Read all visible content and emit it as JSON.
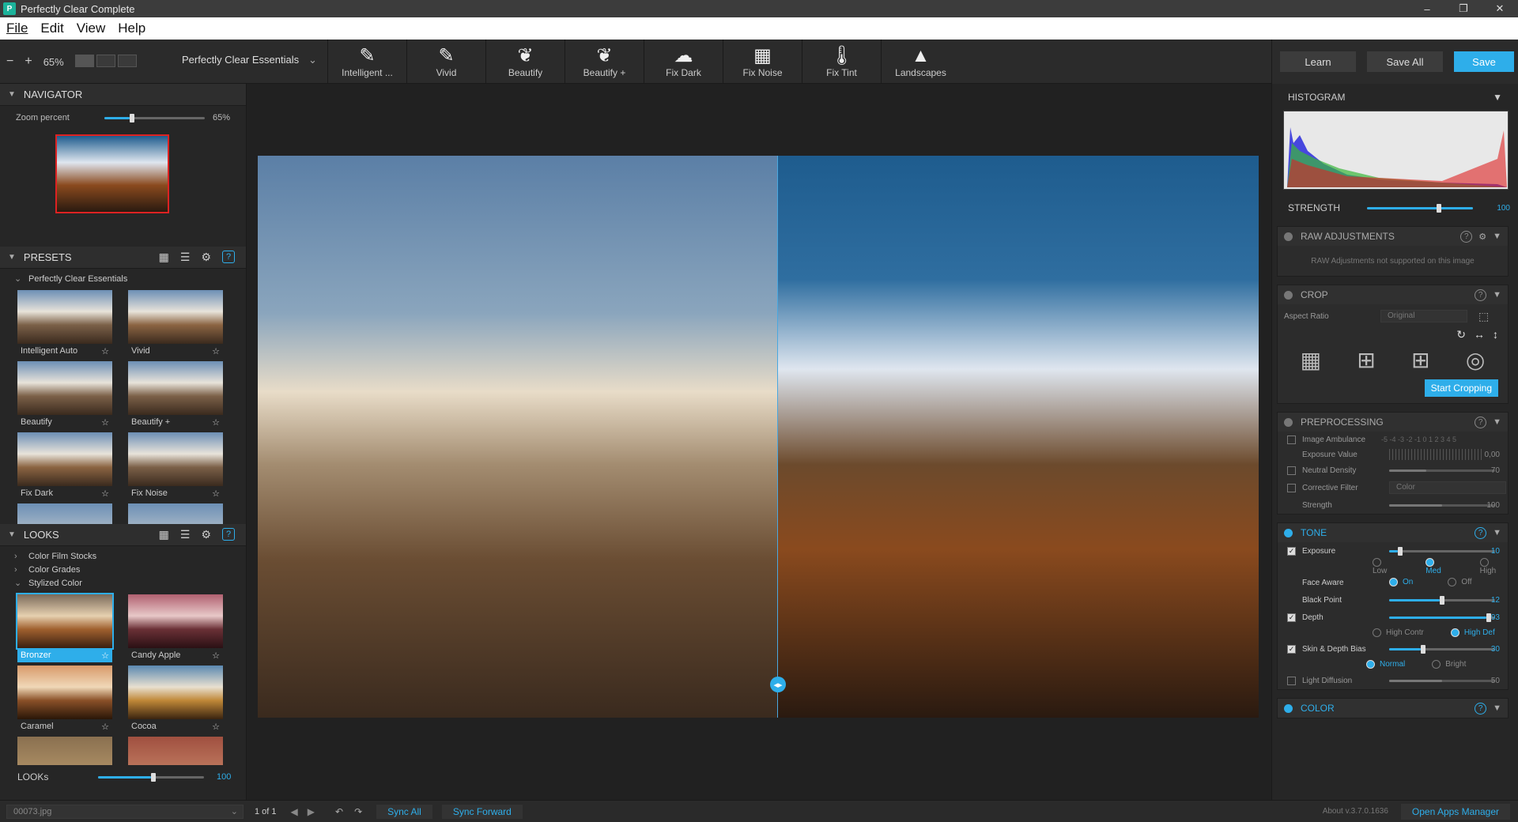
{
  "window": {
    "title": "Perfectly Clear Complete",
    "minimize": "–",
    "maximize": "❐",
    "close": "✕"
  },
  "menu": [
    "File",
    "Edit",
    "View",
    "Help"
  ],
  "toolbar": {
    "zoom_out": "−",
    "zoom_in": "+",
    "zoom_level": "65%",
    "preset_set": "Perfectly Clear Essentials",
    "tools": [
      {
        "label": "Intelligent ...",
        "icon": "intelligent-hd-icon",
        "glyph": "✎"
      },
      {
        "label": "Vivid",
        "icon": "brush-icon",
        "glyph": "✎"
      },
      {
        "label": "Beautify",
        "icon": "face-icon",
        "glyph": "❦"
      },
      {
        "label": "Beautify +",
        "icon": "face-plus-icon",
        "glyph": "❦"
      },
      {
        "label": "Fix Dark",
        "icon": "cloud-icon",
        "glyph": "☁"
      },
      {
        "label": "Fix Noise",
        "icon": "noise-icon",
        "glyph": "▦"
      },
      {
        "label": "Fix Tint",
        "icon": "thermometer-icon",
        "glyph": "🌡"
      },
      {
        "label": "Landscapes",
        "icon": "landscape-icon",
        "glyph": "▲"
      }
    ],
    "learn": "Learn",
    "save_all": "Save All",
    "save": "Save"
  },
  "navigator": {
    "title": "NAVIGATOR",
    "zoom_label": "Zoom percent",
    "zoom_value": "65%",
    "zoom_fraction": 0.25
  },
  "presets": {
    "title": "PRESETS",
    "group": "Perfectly Clear Essentials",
    "items": [
      "Intelligent Auto",
      "Vivid",
      "Beautify",
      "Beautify +",
      "Fix Dark",
      "Fix Noise"
    ]
  },
  "looks": {
    "title": "LOOKS",
    "folders": [
      "Color Film Stocks",
      "Color Grades",
      "Stylized Color"
    ],
    "items": [
      "Bronzer",
      "Candy Apple",
      "Caramel",
      "Cocoa"
    ],
    "selected": "Bronzer",
    "strength_label": "LOOKs",
    "strength_value": "100"
  },
  "histogram": {
    "title": "HISTOGRAM"
  },
  "strength": {
    "label": "STRENGTH",
    "value": "100"
  },
  "raw": {
    "title": "RAW ADJUSTMENTS",
    "note": "RAW Adjustments not supported on this image"
  },
  "crop": {
    "title": "CROP",
    "aspect_label": "Aspect Ratio",
    "aspect_value": "Original",
    "start": "Start Cropping"
  },
  "preprocessing": {
    "title": "PREPROCESSING",
    "ambulance": "Image Ambulance",
    "ambulance_scale": "-5 -4 -3 -2 -1 0 1 2 3 4 5",
    "exposure_value": "Exposure Value",
    "ev": "0,00",
    "neutral_density": "Neutral Density",
    "nd": "70",
    "corrective": "Corrective Filter",
    "corrective_value": "Color",
    "strength": "Strength",
    "strength_value": "100"
  },
  "tone": {
    "title": "TONE",
    "exposure": "Exposure",
    "exposure_value": "10",
    "low": "Low",
    "med": "Med",
    "high": "High",
    "face_aware": "Face Aware",
    "on": "On",
    "off": "Off",
    "black_point": "Black Point",
    "bp": "12",
    "depth": "Depth",
    "depth_value": "93",
    "high_contr": "High Contr",
    "high_def": "High Def",
    "skin_depth": "Skin & Depth Bias",
    "skin_value": "30",
    "normal": "Normal",
    "bright": "Bright",
    "light_diffusion": "Light Diffusion",
    "ld": "50"
  },
  "color": {
    "title": "COLOR"
  },
  "status": {
    "file": "00073.jpg",
    "page": "1 of 1",
    "sync_all": "Sync All",
    "sync_forward": "Sync Forward",
    "version": "About v.3.7.0.1636",
    "open_apps": "Open Apps Manager"
  }
}
